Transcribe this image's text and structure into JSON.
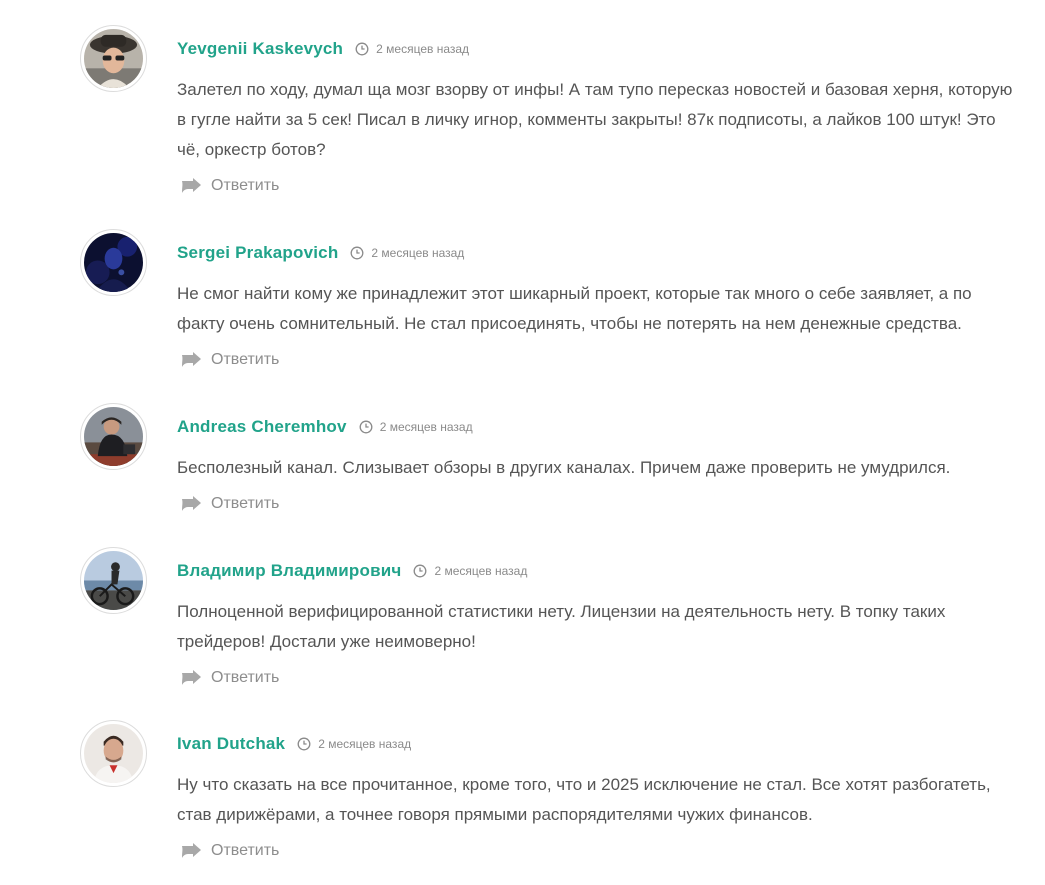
{
  "comments": [
    {
      "author": "Yevgenii Kaskevych",
      "time": "2 месяцев назад",
      "text": "Залетел по ходу, думал ща мозг взорву от инфы! А там тупо пересказ новостей и базовая херня, которую в гугле найти за 5 сек! Писал в личку игнор, комменты закрыты! 87к подписоты, а лайков 100 штук! Это чё, оркестр ботов?",
      "reply": "Ответить"
    },
    {
      "author": "Sergei Prakapovich",
      "time": "2 месяцев назад",
      "text": "Не смог найти кому же принадлежит этот шикарный проект, которые так много о себе заявляет, а по факту очень сомнительный. Не стал присоединять, чтобы не потерять на нем денежные средства.",
      "reply": "Ответить"
    },
    {
      "author": "Andreas Cheremhov",
      "time": "2 месяцев назад",
      "text": "Бесполезный канал. Слизывает обзоры в других каналах. Причем даже проверить не умудрился.",
      "reply": "Ответить"
    },
    {
      "author": "Владимир Владимирович",
      "time": "2 месяцев назад",
      "text": "Полноценной верифицированной статистики нету. Лицензии на деятельность нету. В топку таких трейдеров! Достали уже неимоверно!",
      "reply": "Ответить"
    },
    {
      "author": "Ivan Dutchak",
      "time": "2 месяцев назад",
      "text": "Ну что сказать на все прочитанное, кроме того, что и 2025 исключение не стал. Все хотят разбогатеть, став дирижёрами, а точнее говоря прямыми распорядителями чужих финансов.",
      "reply": "Ответить"
    }
  ],
  "colors": {
    "author": "#21a38a",
    "text": "#555555",
    "meta": "#8a8a8a",
    "reply": "#8d8d8d"
  },
  "icons": {
    "time": "clock-icon",
    "reply": "reply-arrow-icon",
    "avatar": "user-avatar"
  }
}
